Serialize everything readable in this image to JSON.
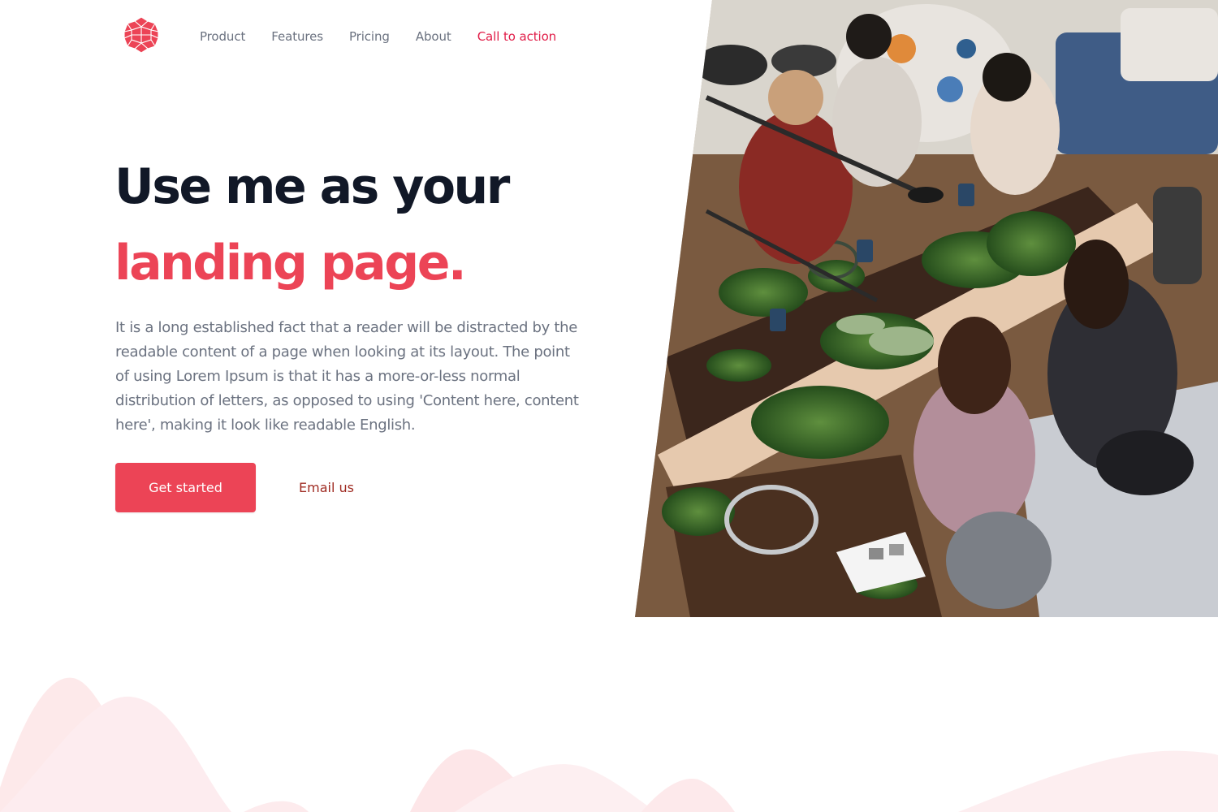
{
  "brand": {
    "logo_icon": "geometric-flower-logo-icon",
    "accent": "#ec4456"
  },
  "nav": {
    "items": [
      {
        "label": "Product"
      },
      {
        "label": "Features"
      },
      {
        "label": "Pricing"
      },
      {
        "label": "About"
      },
      {
        "label": "Call to action"
      }
    ]
  },
  "hero": {
    "headline_line1": "Use me as your",
    "headline_line2": "landing page.",
    "paragraph": "It is a long established fact that a reader will be distracted by the readable content of a page when looking at its layout. The point of using Lorem Ipsum is that it has a more-or-less normal distribution of letters, as opposed to using 'Content here, content here', making it look like readable English.",
    "primary_button": "Get started",
    "secondary_button": "Email us",
    "image_icon": "workshop-photo-image"
  },
  "colors": {
    "heading_dark": "#111827",
    "accent_red": "#ec4456",
    "body_gray": "#6b7280",
    "secondary_link": "#9f2b22",
    "wave_pink": "#fde2e4"
  }
}
